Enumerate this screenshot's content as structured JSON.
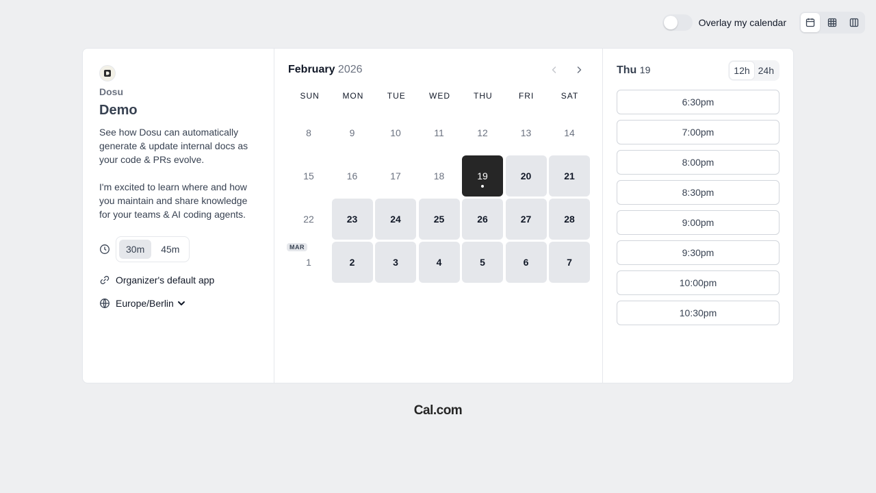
{
  "topbar": {
    "overlay_label": "Overlay my calendar",
    "overlay_on": false,
    "views": [
      {
        "icon": "calendar-icon",
        "active": true
      },
      {
        "icon": "grid-icon",
        "active": false
      },
      {
        "icon": "columns-icon",
        "active": false
      }
    ]
  },
  "event": {
    "organizer": "Dosu",
    "title": "Demo",
    "description": "See how Dosu can automatically generate & update internal docs as your code & PRs evolve.\n\nI'm excited to learn where and how you maintain and share knowledge for your teams & AI coding agents.",
    "durations": [
      "30m",
      "45m"
    ],
    "selected_duration": "30m",
    "location": "Organizer's default app",
    "timezone": "Europe/Berlin"
  },
  "calendar": {
    "month": "February",
    "year": "2026",
    "weekdays": [
      "SUN",
      "MON",
      "TUE",
      "WED",
      "THU",
      "FRI",
      "SAT"
    ],
    "next_month_badge": "MAR",
    "weeks": [
      [
        {
          "d": "8"
        },
        {
          "d": "9"
        },
        {
          "d": "10"
        },
        {
          "d": "11"
        },
        {
          "d": "12"
        },
        {
          "d": "13"
        },
        {
          "d": "14"
        }
      ],
      [
        {
          "d": "15"
        },
        {
          "d": "16"
        },
        {
          "d": "17"
        },
        {
          "d": "18"
        },
        {
          "d": "19",
          "avail": true,
          "selected": true
        },
        {
          "d": "20",
          "avail": true
        },
        {
          "d": "21",
          "avail": true
        }
      ],
      [
        {
          "d": "22"
        },
        {
          "d": "23",
          "avail": true
        },
        {
          "d": "24",
          "avail": true
        },
        {
          "d": "25",
          "avail": true
        },
        {
          "d": "26",
          "avail": true
        },
        {
          "d": "27",
          "avail": true
        },
        {
          "d": "28",
          "avail": true
        }
      ],
      [
        {
          "d": "1",
          "badge": true
        },
        {
          "d": "2",
          "avail": true
        },
        {
          "d": "3",
          "avail": true
        },
        {
          "d": "4",
          "avail": true
        },
        {
          "d": "5",
          "avail": true
        },
        {
          "d": "6",
          "avail": true
        },
        {
          "d": "7",
          "avail": true
        }
      ]
    ]
  },
  "slots": {
    "day_name": "Thu",
    "day_num": "19",
    "formats": [
      "12h",
      "24h"
    ],
    "selected_format": "12h",
    "times": [
      "6:30pm",
      "7:00pm",
      "8:00pm",
      "8:30pm",
      "9:00pm",
      "9:30pm",
      "10:00pm",
      "10:30pm"
    ]
  },
  "brand": "Cal.com"
}
